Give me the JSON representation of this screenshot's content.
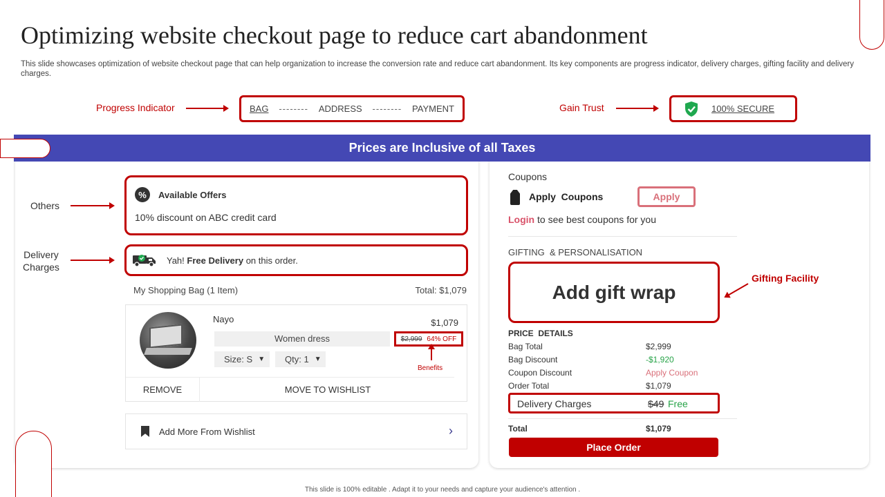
{
  "title": "Optimizing website checkout page to reduce cart abandonment",
  "subtitle": "This slide showcases optimization of website checkout page that can help organization to increase the conversion rate and reduce cart abandonment. Its key components are progress indicator, delivery charges, gifting facility and delivery charges.",
  "annotations": {
    "progress_indicator": "Progress Indicator",
    "gain_trust": "Gain Trust",
    "others": "Others",
    "delivery_charges_line1": "Delivery",
    "delivery_charges_line2": "Charges",
    "benefits": "Benefits",
    "gifting_facility": "Gifting Facility"
  },
  "progress": {
    "steps": [
      "BAG",
      "ADDRESS",
      "PAYMENT"
    ],
    "separator": "--------"
  },
  "secure": {
    "label": "100% SECURE",
    "icon": "shield-check-icon"
  },
  "banner": "Prices are Inclusive of all Taxes",
  "offers": {
    "title": "Available Offers",
    "icon": "percent-badge-icon",
    "icon_glyph": "%",
    "text": "10% discount on ABC credit card"
  },
  "delivery": {
    "prefix": "Yah!",
    "bold": "Free Delivery",
    "suffix": "on this order.",
    "icon": "delivery-truck-icon"
  },
  "bag": {
    "heading": "My Shopping Bag (1 Item)",
    "total": "Total: $1,079",
    "item": {
      "name": "Nayo",
      "price": "$1,079",
      "description": "Women dress",
      "old_price": "$2,999",
      "discount": "64% OFF",
      "size": "Size: S",
      "qty": "Qty: 1",
      "remove": "REMOVE",
      "move_to_wishlist": "MOVE TO WISHLIST"
    },
    "add_wishlist": "Add More From Wishlist"
  },
  "coupons": {
    "title": "Coupons",
    "apply_coupons": "Apply  Coupons",
    "apply_button": "Apply",
    "login": "Login",
    "login_suffix": "to see best coupons for you"
  },
  "gifting": {
    "heading": "GIFTING  & PERSONALISATION",
    "gift_wrap": "Add gift wrap"
  },
  "price_details": {
    "heading": "PRICE  DETAILS",
    "rows": [
      {
        "label": "Bag Total",
        "value": "$2,999"
      },
      {
        "label": "Bag Discount",
        "value": "-$1,920"
      },
      {
        "label": "Coupon Discount",
        "value": "Apply Coupon"
      },
      {
        "label": "Order Total",
        "value": "$1,079"
      }
    ],
    "delivery_label": "Delivery Charges",
    "delivery_old": "$49",
    "delivery_free": "Free",
    "total_label": "Total",
    "total_value": "$1,079"
  },
  "place_order": "Place Order",
  "footer": "This slide is 100% editable . Adapt it to your needs and capture your audience's attention .",
  "colors": {
    "accent_red": "#c00000",
    "banner_blue": "#4448b4",
    "green": "#27a348",
    "pink": "#d9707a"
  }
}
